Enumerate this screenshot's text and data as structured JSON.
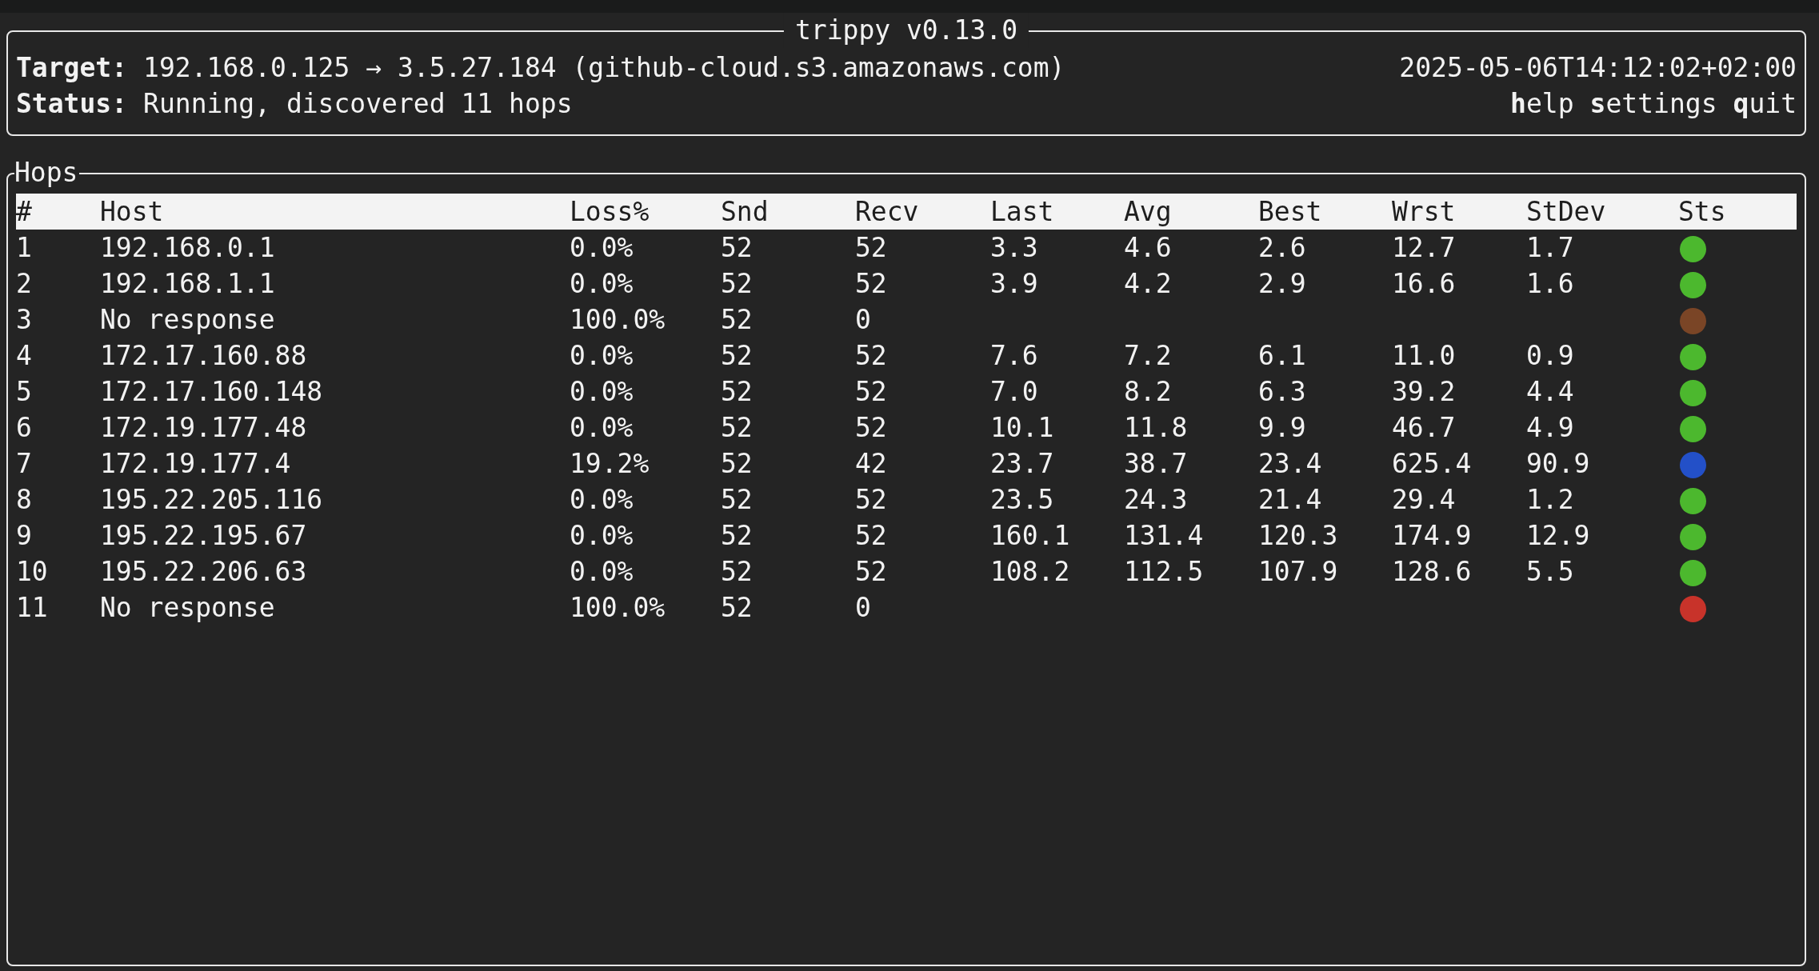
{
  "header": {
    "title": "trippy v0.13.0",
    "target_label": "Target:",
    "target": "192.168.0.125 → 3.5.27.184 (github-cloud.s3.amazonaws.com)",
    "timestamp": "2025-05-06T14:12:02+02:00",
    "status_label": "Status:",
    "status": "Running, discovered 11 hops",
    "actions": [
      "**h**elp",
      "**s**ettings",
      "**q**uit"
    ]
  },
  "hops": {
    "title": "Hops",
    "columns": [
      "#",
      "Host",
      "Loss%",
      "Snd",
      "Recv",
      "Last",
      "Avg",
      "Best",
      "Wrst",
      "StDev",
      "Sts"
    ],
    "rows": [
      {
        "cells": [
          "1",
          "192.168.0.1",
          "0.0%",
          "52",
          "52",
          "3.3",
          "4.6",
          "2.6",
          "12.7",
          "1.7"
        ],
        "color": "#4cb82e"
      },
      {
        "cells": [
          "2",
          "192.168.1.1",
          "0.0%",
          "52",
          "52",
          "3.9",
          "4.2",
          "2.9",
          "16.6",
          "1.6"
        ],
        "color": "#4cb82e"
      },
      {
        "cells": [
          "3",
          "No response",
          "100.0%",
          "52",
          "0",
          "",
          "",
          "",
          "",
          ""
        ],
        "color": "#7a4526"
      },
      {
        "cells": [
          "4",
          "172.17.160.88",
          "0.0%",
          "52",
          "52",
          "7.6",
          "7.2",
          "6.1",
          "11.0",
          "0.9"
        ],
        "color": "#4cb82e"
      },
      {
        "cells": [
          "5",
          "172.17.160.148",
          "0.0%",
          "52",
          "52",
          "7.0",
          "8.2",
          "6.3",
          "39.2",
          "4.4"
        ],
        "color": "#4cb82e"
      },
      {
        "cells": [
          "6",
          "172.19.177.48",
          "0.0%",
          "52",
          "52",
          "10.1",
          "11.8",
          "9.9",
          "46.7",
          "4.9"
        ],
        "color": "#4cb82e"
      },
      {
        "cells": [
          "7",
          "172.19.177.4",
          "19.2%",
          "52",
          "42",
          "23.7",
          "38.7",
          "23.4",
          "625.4",
          "90.9"
        ],
        "color": "#2350c8"
      },
      {
        "cells": [
          "8",
          "195.22.205.116",
          "0.0%",
          "52",
          "52",
          "23.5",
          "24.3",
          "21.4",
          "29.4",
          "1.2"
        ],
        "color": "#4cb82e"
      },
      {
        "cells": [
          "9",
          "195.22.195.67",
          "0.0%",
          "52",
          "52",
          "160.1",
          "131.4",
          "120.3",
          "174.9",
          "12.9"
        ],
        "color": "#4cb82e"
      },
      {
        "cells": [
          "10",
          "195.22.206.63",
          "0.0%",
          "52",
          "52",
          "108.2",
          "112.5",
          "107.9",
          "128.6",
          "5.5"
        ],
        "color": "#4cb82e"
      },
      {
        "cells": [
          "11",
          "No response",
          "100.0%",
          "52",
          "0",
          "",
          "",
          "",
          "",
          ""
        ],
        "color": "#c8332a"
      }
    ]
  }
}
